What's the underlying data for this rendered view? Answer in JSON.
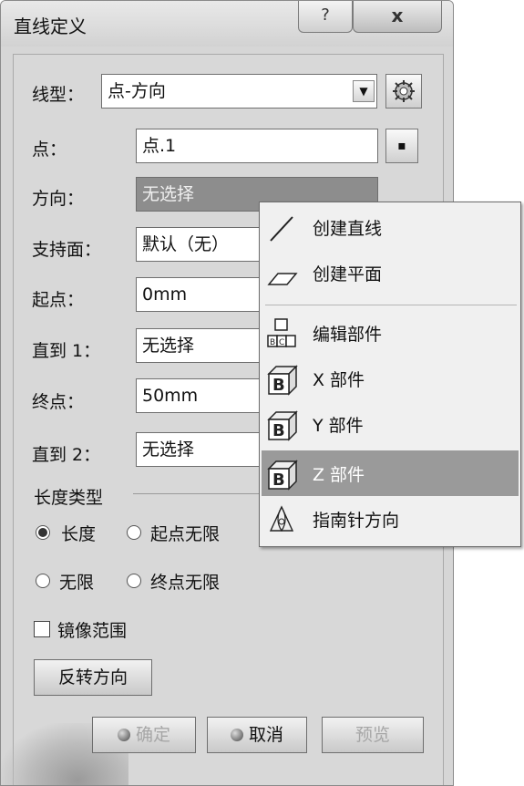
{
  "window": {
    "title": "直线定义",
    "help_label": "?",
    "close_label": "x"
  },
  "form": {
    "line_type_label": "线型：",
    "line_type_value": "点-方向",
    "dropdown_arrow": "▼",
    "point_label": "点：",
    "point_value": "点.1",
    "point_button": "▪",
    "direction_label": "方向：",
    "direction_value": "无选择",
    "support_label": "支持面：",
    "support_value": "默认（无）",
    "start_label": "起点：",
    "start_value": "0mm",
    "upto1_label": "直到 1：",
    "upto1_value": "无选择",
    "end_label": "终点：",
    "end_value": "50mm",
    "upto2_label": "直到 2：",
    "upto2_value": "无选择"
  },
  "length_type": {
    "group_label": "长度类型",
    "options": [
      {
        "label": "长度",
        "selected": true
      },
      {
        "label": "起点无限",
        "selected": false
      },
      {
        "label": "无限",
        "selected": false
      },
      {
        "label": "终点无限",
        "selected": false
      }
    ]
  },
  "mirror": {
    "label": "镜像范围",
    "checked": false
  },
  "reverse_button": "反转方向",
  "footer": {
    "ok": "确定",
    "cancel": "取消",
    "preview": "预览"
  },
  "context_menu": {
    "items": [
      {
        "label": "创建直线",
        "icon": "line-icon"
      },
      {
        "label": "创建平面",
        "icon": "plane-icon"
      },
      {
        "label": "编辑部件",
        "icon": "components-icon"
      },
      {
        "label": "X 部件",
        "icon": "box-b-icon"
      },
      {
        "label": "Y 部件",
        "icon": "box-b-icon"
      },
      {
        "label": "Z 部件",
        "icon": "box-b-icon",
        "highlighted": true
      },
      {
        "label": "指南针方向",
        "icon": "compass-icon"
      }
    ]
  },
  "colors": {
    "dialog_bg": "#d8d8d8",
    "disabled_field": "#8d8d8d",
    "menu_highlight": "#9a9a9a"
  }
}
